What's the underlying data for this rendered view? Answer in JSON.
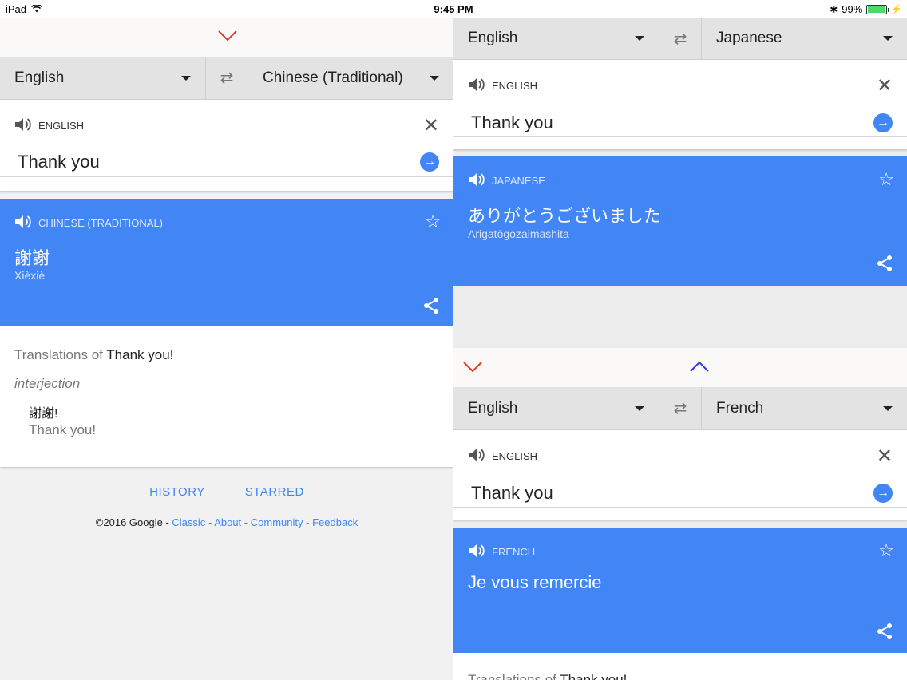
{
  "status": {
    "device": "iPad",
    "time": "9:45 PM",
    "battery": "99%",
    "battery_level": 0.99
  },
  "left": {
    "source_lang": "English",
    "target_lang": "Chinese (Traditional)",
    "input_label": "ENGLISH",
    "input_text": "Thank you",
    "result_label": "CHINESE (TRADITIONAL)",
    "result_text": "謝謝",
    "result_translit": "Xièxiè",
    "translations_prefix": "Translations of",
    "translations_term": "Thank you!",
    "part_of_speech": "interjection",
    "def_term": "謝謝!",
    "def_gloss": "Thank you!",
    "footer_tabs": [
      "HISTORY",
      "STARRED"
    ],
    "copyright": "©2016 Google -",
    "footer_links": [
      "Classic",
      "About",
      "Community",
      "Feedback"
    ]
  },
  "right_top": {
    "source_lang": "English",
    "target_lang": "Japanese",
    "input_label": "ENGLISH",
    "input_text": "Thank you",
    "result_label": "JAPANESE",
    "result_text": "ありがとうございました",
    "result_translit": "Arigatōgozaimashita"
  },
  "right_bottom": {
    "source_lang": "English",
    "target_lang": "French",
    "input_label": "ENGLISH",
    "input_text": "Thank you",
    "result_label": "FRENCH",
    "result_text": "Je vous remercie",
    "translations_prefix": "Translations of",
    "translations_term": "Thank you!"
  },
  "colors": {
    "accent": "#4285f4",
    "chevron_red": "#e0392b",
    "chevron_blue": "#2a3bd9"
  }
}
